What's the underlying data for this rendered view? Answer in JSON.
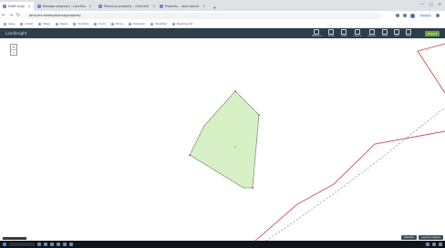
{
  "browser": {
    "tabs": [
      {
        "label": "Draft map",
        "active": true
      },
      {
        "label": "Manage property - LandIns"
      },
      {
        "label": "Planning property - OnlineSt"
      },
      {
        "label": "Property - land parcel"
      }
    ],
    "new_tab_label": "+",
    "window_controls": [
      "—",
      "□",
      "✕"
    ],
    "address": "land-ins.example/map/property",
    "bookmarks": [
      "Apps",
      "Gmail",
      "Maps",
      "News",
      "YouTube",
      "Docs",
      "Drive",
      "Calendar",
      "Weather",
      "Reading list"
    ],
    "profile_chip": "Paused"
  },
  "app": {
    "logo_label": "LandInsight",
    "tools": [
      "Measure",
      "Draw",
      "Label",
      "Layers",
      "Search",
      "Print",
      "Info",
      "Help"
    ],
    "export_label": "Export"
  },
  "map": {
    "zoom_in": "+",
    "zoom_out": "−",
    "fill_color": "#d8f0c6",
    "outline_color": "#556b55",
    "boundary_color": "#c85555",
    "buttons": [
      "Satellite",
      "Layers & legend"
    ]
  },
  "colors": {
    "tab_bar": "#dee1e6",
    "toolbar": "#2d3e48",
    "accent": "#6ea53d",
    "taskbar": "#10151c"
  }
}
